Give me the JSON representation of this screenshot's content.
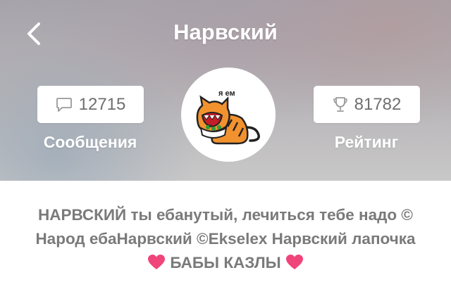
{
  "header": {
    "title": "Нарвский",
    "messages": {
      "count": "12715",
      "label": "Сообщения",
      "icon": "chat-bubble-icon"
    },
    "rating": {
      "count": "81782",
      "label": "Рейтинг",
      "icon": "trophy-icon"
    },
    "avatar": {
      "caption": "я ем",
      "icon": "cat-eating-avatar"
    }
  },
  "bio": {
    "line1": "НАРВСКИЙ ты ебанутый, лечиться тебе надо ©",
    "line2": "Народ ебаНарвский ©Ekselex Нарвский лапочка",
    "line3": "БАБЫ КАЗЛЫ",
    "heart_color": "#f0457a"
  },
  "colors": {
    "text_muted": "#7a7a7a",
    "pill_text": "#6f6f6f"
  }
}
